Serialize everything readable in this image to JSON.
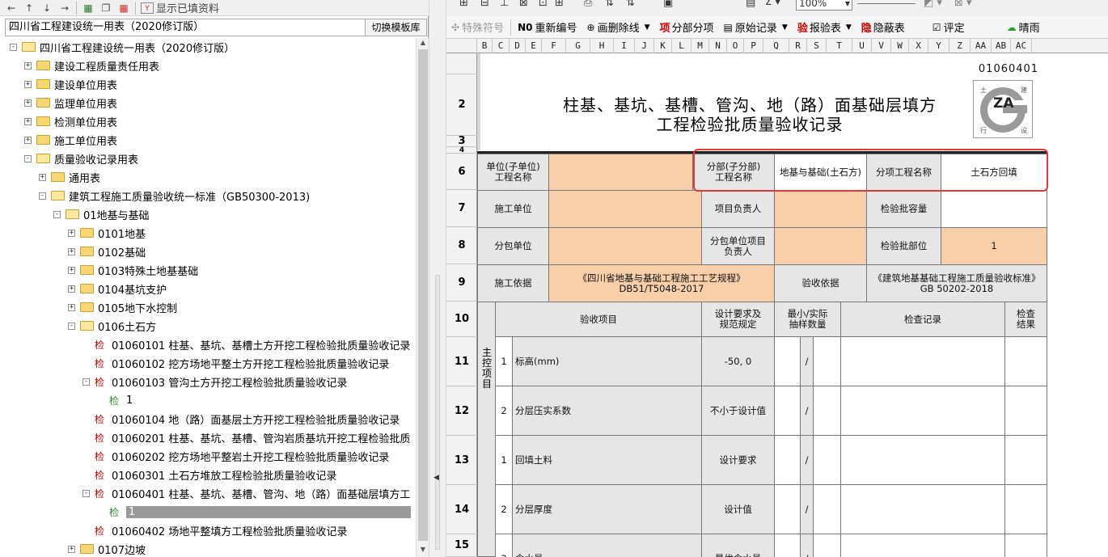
{
  "left": {
    "toolbar": {
      "show_filled_label": "显示已填资料"
    },
    "template": {
      "value": "四川省工程建设统一用表（2020修订版）",
      "switch_label": "切换模板库"
    },
    "tree": [
      {
        "label": "四川省工程建设统一用表（2020修订版）",
        "exp": "-",
        "kind": "folder-open"
      },
      {
        "label": "建设工程质量责任用表",
        "exp": "+",
        "kind": "folder"
      },
      {
        "label": "建设单位用表",
        "exp": "+",
        "kind": "folder"
      },
      {
        "label": "监理单位用表",
        "exp": "+",
        "kind": "folder"
      },
      {
        "label": "检测单位用表",
        "exp": "+",
        "kind": "folder"
      },
      {
        "label": "施工单位用表",
        "exp": "+",
        "kind": "folder"
      },
      {
        "label": "质量验收记录用表",
        "exp": "-",
        "kind": "folder-open"
      },
      {
        "label": "通用表",
        "exp": "+",
        "kind": "folder"
      },
      {
        "label": "建筑工程施工质量验收统一标准（GB50300-2013)",
        "exp": "-",
        "kind": "folder-open"
      },
      {
        "label": "01地基与基础",
        "exp": "-",
        "kind": "folder-open"
      },
      {
        "label": "0101地基",
        "exp": "+",
        "kind": "folder"
      },
      {
        "label": "0102基础",
        "exp": "+",
        "kind": "folder"
      },
      {
        "label": "0103特殊土地基基础",
        "exp": "+",
        "kind": "folder"
      },
      {
        "label": "0104基坑支护",
        "exp": "+",
        "kind": "folder"
      },
      {
        "label": "0105地下水控制",
        "exp": "+",
        "kind": "folder"
      },
      {
        "label": "0106土石方",
        "exp": "-",
        "kind": "folder-open"
      },
      {
        "label": "01060101 柱基、基坑、基槽土方开挖工程检验批质量验收记录",
        "kind": "doc"
      },
      {
        "label": "01060102 挖方场地平整土方开挖工程检验批质量验收记录",
        "kind": "doc"
      },
      {
        "label": "01060103 管沟土方开挖工程检验批质量验收记录",
        "exp": "-",
        "kind": "doc"
      },
      {
        "label": "1",
        "kind": "doc-g"
      },
      {
        "label": "01060104 地（路）面基层土方开挖工程检验批质量验收记录",
        "kind": "doc"
      },
      {
        "label": "01060201 柱基、基坑、基槽、管沟岩质基坑开挖工程检验批质",
        "kind": "doc"
      },
      {
        "label": "01060202 挖方场地平整岩土开挖工程检验批质量验收记录",
        "kind": "doc"
      },
      {
        "label": "01060301 土石方堆放工程检验批质量验收记录",
        "kind": "doc"
      },
      {
        "label": "01060401 柱基、基坑、基槽、管沟、地（路）面基础层填方工",
        "exp": "-",
        "kind": "doc"
      },
      {
        "label": "1",
        "kind": "doc-g",
        "selected": true
      },
      {
        "label": "01060402 场地平整填方工程检验批质量验收记录",
        "kind": "doc"
      },
      {
        "label": "0107边坡",
        "exp": "+",
        "kind": "folder"
      }
    ],
    "doc_mark": "检"
  },
  "right": {
    "toolbar1": {
      "zoom": "100%"
    },
    "toolbar2": {
      "special_symbol": "特殊符号",
      "renumber": "重新编号",
      "delete_line": "画删除线",
      "sub_item": "分部分项",
      "sub_item_mark": "项",
      "raw_record": "原始记录",
      "report": "报验表",
      "report_mark": "验",
      "hidden": "隐蔽表",
      "hidden_mark": "隐",
      "evaluate": "评定",
      "cloud": "晴雨"
    },
    "columns": [
      "B",
      "C",
      "D",
      "E",
      "F",
      "G",
      "H",
      "I",
      "J",
      "K",
      "L",
      "M",
      "N",
      "O",
      "P",
      "Q",
      "R",
      "S",
      "T",
      "U",
      "V",
      "W",
      "X",
      "Y",
      "Z",
      "AA",
      "AB",
      "AC"
    ],
    "rows": [
      "2",
      "3",
      "4",
      "6",
      "7",
      "8",
      "9",
      "10",
      "11",
      "12",
      "13",
      "14",
      "15"
    ],
    "form": {
      "code": "01060401",
      "title_line1": "柱基、基坑、基槽、管沟、地（路）面基础层填方",
      "title_line2": "工程检验批质量验收记录",
      "logo_text": "ZA",
      "logo_corner": [
        "土",
        "建",
        "行",
        "设"
      ],
      "unit_label": "单位(子单位)\n工程名称",
      "subdiv_label": "分部(子分部)\n工程名称",
      "subdiv_value": "地基与基础(土石方)",
      "subitem_label": "分项工程名称",
      "subitem_value": "土石方回填",
      "contractor_label": "施工单位",
      "pm_label": "项目负责人",
      "capacity_label": "检验批容量",
      "subcontractor_label": "分包单位",
      "sub_pm_label": "分包单位项目\n负责人",
      "location_label": "检验批部位",
      "location_value": "1",
      "basis_label": "施工依据",
      "basis_value": "《四川省地基与基础工程施工工艺规程》\nDB51/T5048-2017",
      "accept_basis_label": "验收依据",
      "accept_basis_value": "《建筑地基基础工程施工质量验收标准》\nGB 50202-2018",
      "hdr_item": "验收项目",
      "hdr_design": "设计要求及\n规范规定",
      "hdr_sample": "最小/实际\n抽样数量",
      "hdr_record": "检查记录",
      "hdr_result": "检查\n结果",
      "main_ctrl": "主控项目",
      "slash": "/",
      "items": [
        {
          "no": "1",
          "name": "标高(mm)",
          "design": "-50, 0"
        },
        {
          "no": "2",
          "name": "分层压实系数",
          "design": "不小于设计值"
        },
        {
          "no": "1",
          "name": "回填土料",
          "design": "设计要求"
        },
        {
          "no": "2",
          "name": "分层厚度",
          "design": "设计值"
        },
        {
          "no": "3",
          "name": "含水量",
          "design": "最优含水量"
        }
      ]
    }
  }
}
